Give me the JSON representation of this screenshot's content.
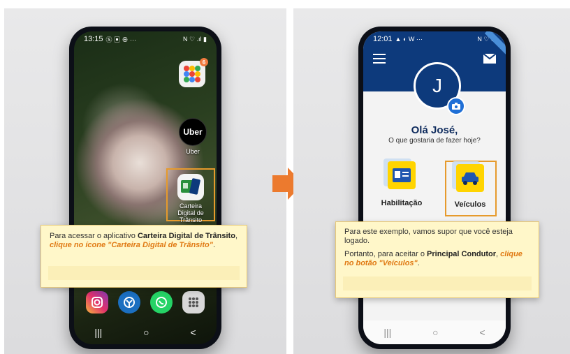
{
  "left_phone": {
    "status_time": "13:15",
    "status_icons_left": "Ⓢ ▣ ⊕ ···",
    "status_icons_right": "N ♡ .ıl ▮",
    "apps": {
      "google_folder_badge": "6",
      "uber_icon_text": "Uber",
      "uber_label": "Uber",
      "cdt_label": "Carteira Digital de Trânsito"
    },
    "callout": {
      "text1": "Para acessar o aplicativo ",
      "bold": "Carteira Digital de Trânsito",
      "text2": ", ",
      "italic": "clique no ícone \"Carteira Digital de Trânsito\"",
      "text3": "."
    }
  },
  "right_phone": {
    "status_time": "12:01",
    "status_icons_left": "▲ ◐ W ···",
    "status_icons_right": "N ♡ .ıl",
    "avatar_letter": "J",
    "greeting": "Olá José,",
    "subtitle": "O que gostaria de fazer hoje?",
    "option_habilitacao": "Habilitação",
    "option_veiculos": "Veículos",
    "callout": {
      "line1": "Para este exemplo, vamos supor que você esteja logado.",
      "line2_text1": "Portanto, para aceitar o ",
      "line2_bold": "Principal Condutor",
      "line2_text2": ", ",
      "line2_italic": "clique no botão \"Veículos\"",
      "line2_text3": "."
    }
  },
  "nav": {
    "recents": "|||",
    "home": "○",
    "back": "<"
  },
  "colors": {
    "brand_blue": "#0d3a7c",
    "accent_orange": "#e69a2c",
    "arrow_orange": "#ec7a2e",
    "callout_bg": "#fff7c9"
  }
}
